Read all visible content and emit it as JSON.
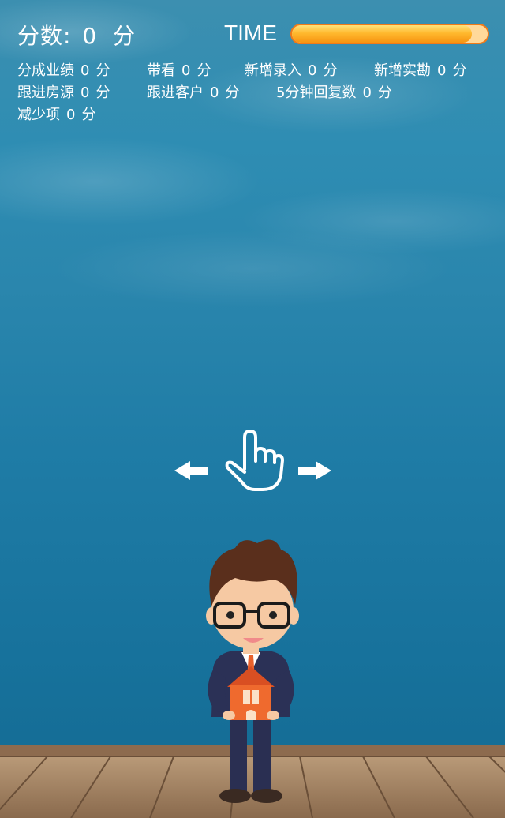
{
  "hud": {
    "score_label": "分数:",
    "score_value": "0",
    "score_unit": "分",
    "time_label": "TIME",
    "time_remaining_fraction": 0.92
  },
  "stats": [
    [
      {
        "label": "分成业绩",
        "value": "0",
        "unit": "分"
      },
      {
        "label": "带看",
        "value": "0",
        "unit": "分"
      },
      {
        "label": "新增录入",
        "value": "0",
        "unit": "分"
      },
      {
        "label": "新增实勘",
        "value": "0",
        "unit": "分"
      }
    ],
    [
      {
        "label": "跟进房源",
        "value": "0",
        "unit": "分"
      },
      {
        "label": "跟进客户",
        "value": "0",
        "unit": "分"
      },
      {
        "label": "5分钟回复数",
        "value": "0",
        "unit": "分"
      }
    ],
    [
      {
        "label": "减少项",
        "value": "0",
        "unit": "分"
      }
    ]
  ],
  "icons": {
    "left": "arrow-left-icon",
    "hand": "pointing-hand-icon",
    "right": "arrow-right-icon"
  },
  "colors": {
    "timer_fill": "#ffb92e",
    "timer_border": "#f07a18",
    "sky_top": "#3c8fb0",
    "sky_bottom": "#136a92",
    "deck": "#9b7a5c"
  }
}
